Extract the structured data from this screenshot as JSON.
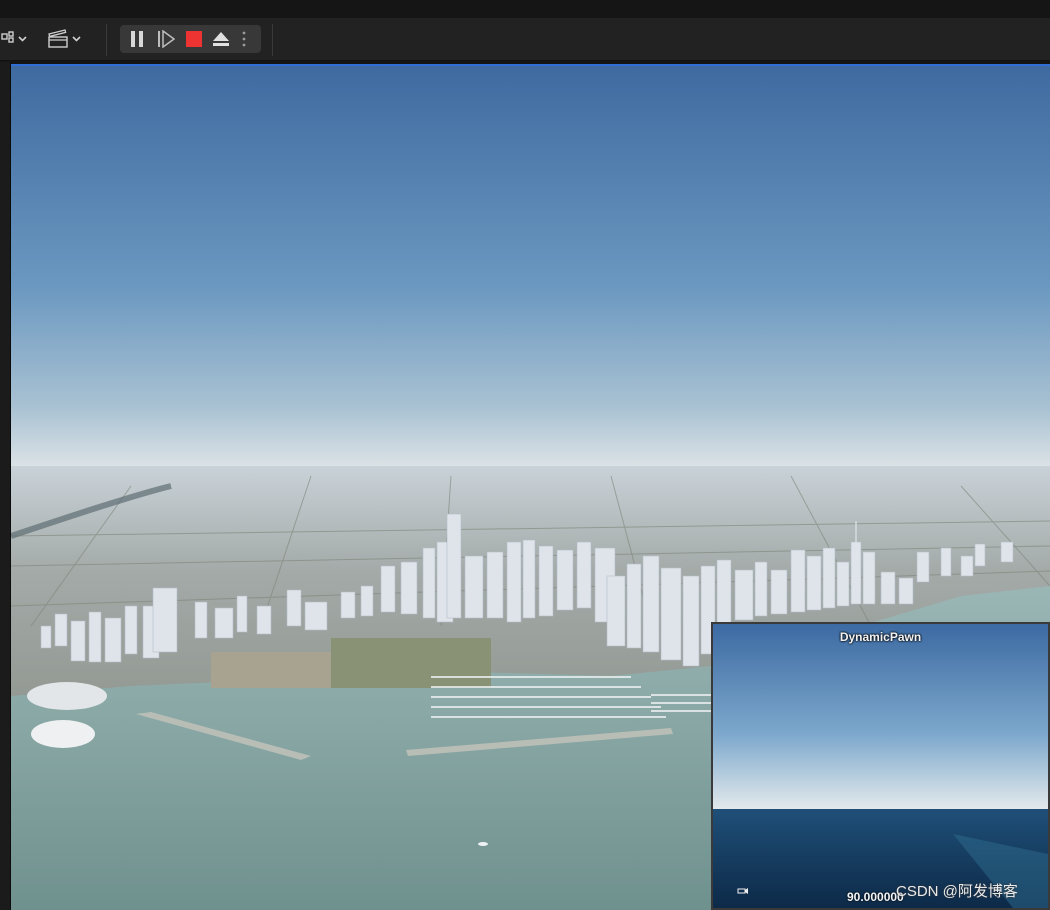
{
  "toolbar": {
    "layout_icon": "viewport-layout-icon",
    "cinematics_icon": "clapperboard-icon",
    "play_controls": {
      "pause_icon": "pause-icon",
      "step_icon": "frame-step-icon",
      "stop_icon": "stop-icon",
      "eject_icon": "eject-icon",
      "more_icon": "kebab-menu-icon"
    }
  },
  "viewport": {
    "scene": "city-skyline-aerial-view"
  },
  "pip": {
    "title": "DynamicPawn",
    "readout": "90.000000"
  },
  "watermark": "CSDN @阿发博客",
  "colors": {
    "accent": "#2f6fd6",
    "stop": "#ee3333",
    "sky_top": "#3e6aa0",
    "sky_horizon": "#dce3e6",
    "water": "#7e9e9c"
  }
}
